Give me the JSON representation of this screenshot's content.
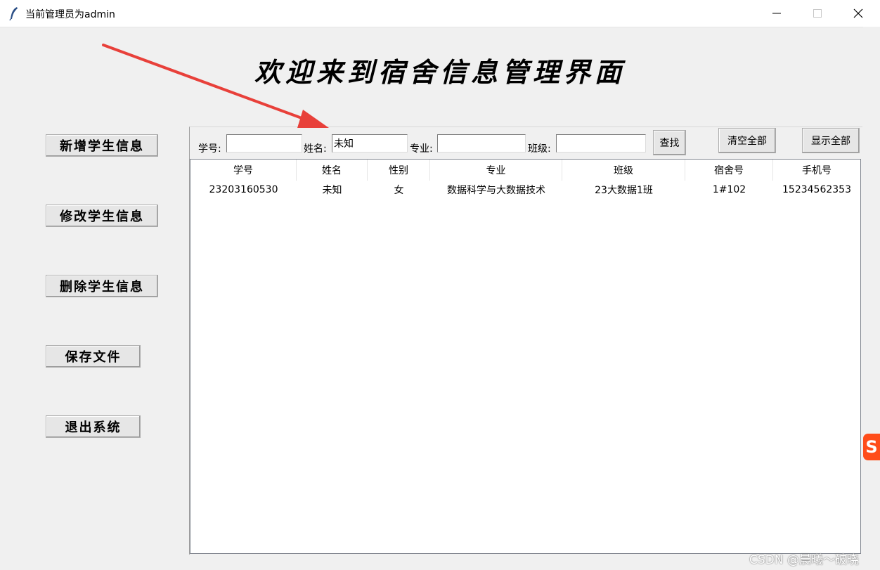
{
  "window": {
    "title": "当前管理员为admin",
    "minimize_icon": "minimize-icon",
    "maximize_icon": "maximize-icon",
    "close_icon": "close-icon",
    "app_icon": "feather-icon"
  },
  "heading": "欢迎来到宿舍信息管理界面",
  "sidebar": {
    "add": "新增学生信息",
    "edit": "修改学生信息",
    "delete": "删除学生信息",
    "save": "保存文件",
    "exit": "退出系统"
  },
  "search": {
    "id_label": "学号:",
    "id_value": "",
    "name_label": "姓名:",
    "name_value": "未知",
    "major_label": "专业:",
    "major_value": "",
    "class_label": "班级:",
    "class_value": "",
    "find": "查找",
    "clear_all": "清空全部",
    "show_all": "显示全部"
  },
  "table": {
    "columns": [
      "学号",
      "姓名",
      "性别",
      "专业",
      "班级",
      "宿舍号",
      "手机号"
    ],
    "rows": [
      [
        "23203160530",
        "未知",
        "女",
        "数据科学与大数据技术",
        "23大数据1班",
        "1#102",
        "15234562353"
      ]
    ]
  },
  "overlay": {
    "ime_badge": "S",
    "watermark": "CSDN @晨曦～破晓",
    "arrow_color": "#e8403a"
  }
}
